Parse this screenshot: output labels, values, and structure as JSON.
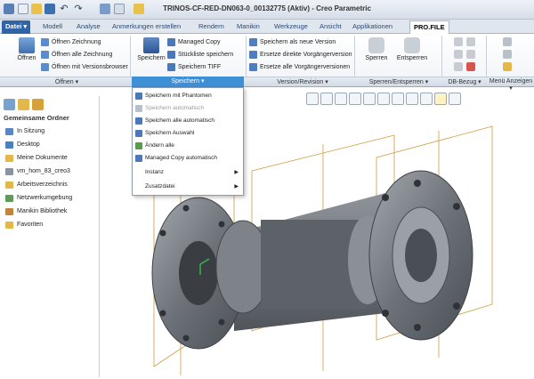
{
  "window": {
    "title": "TRINOS-CF-RED-DN063-0_00132775 (Aktiv) - Creo Parametric"
  },
  "tabs": [
    {
      "label": "Datei ▾"
    },
    {
      "label": "Modell"
    },
    {
      "label": "Analyse"
    },
    {
      "label": "Anmerkungen erstellen"
    },
    {
      "label": "Rendern"
    },
    {
      "label": "Manikin"
    },
    {
      "label": "Werkzeuge"
    },
    {
      "label": "Ansicht"
    },
    {
      "label": "Applikationen"
    },
    {
      "label": "PRO.FILE"
    }
  ],
  "ribbon": {
    "open_big": "Öffnen",
    "open_items": [
      "Öffnen Zeichnung",
      "Öffnen alle Zeichnung",
      "Öffnen mit Versionsbrowser"
    ],
    "save_big": "Speichern",
    "save_items": [
      "Managed Copy",
      "Stückliste speichern",
      "Speichern TIFF"
    ],
    "version_items": [
      "Speichern als neue Version",
      "Ersetze direkte Vorgängerversion",
      "Ersetze alle Vorgängerversionen"
    ],
    "lock_big": "Sperren",
    "unlock_big": "Entsperren",
    "groups": [
      "Öffnen ▾",
      "Speichern ▾",
      "Version/Revision ▾",
      "Sperren/Entsperren ▾",
      "DB-Bezug ▾",
      "Menü Anzeigen ▾"
    ]
  },
  "save_menu": {
    "items": [
      {
        "label": "Speichern mit Phantomen",
        "enabled": true
      },
      {
        "label": "Speichern automatisch",
        "enabled": false
      },
      {
        "label": "Speichern alle automatisch",
        "enabled": true
      },
      {
        "label": "Speichern Auswahl",
        "enabled": true
      },
      {
        "label": "Ändern alle",
        "enabled": true
      },
      {
        "label": "Managed Copy automatisch",
        "enabled": true
      },
      {
        "label": "Instanz",
        "enabled": true
      },
      {
        "label": "Zusatzdatei",
        "enabled": true
      }
    ]
  },
  "navigator": {
    "heading": "Gemeinsame Ordner",
    "items": [
      "In Sitzung",
      "Desktop",
      "Meine Dokumente",
      "vm_hom_83_creo3",
      "Arbeitsverzeichnis",
      "Netzwerkumgebung",
      "Manikin Bibliothek",
      "Favoriten"
    ]
  },
  "colors": {
    "accent": "#3d8fd6",
    "file_tab": "#2f64a8",
    "model": "#6f747b"
  }
}
